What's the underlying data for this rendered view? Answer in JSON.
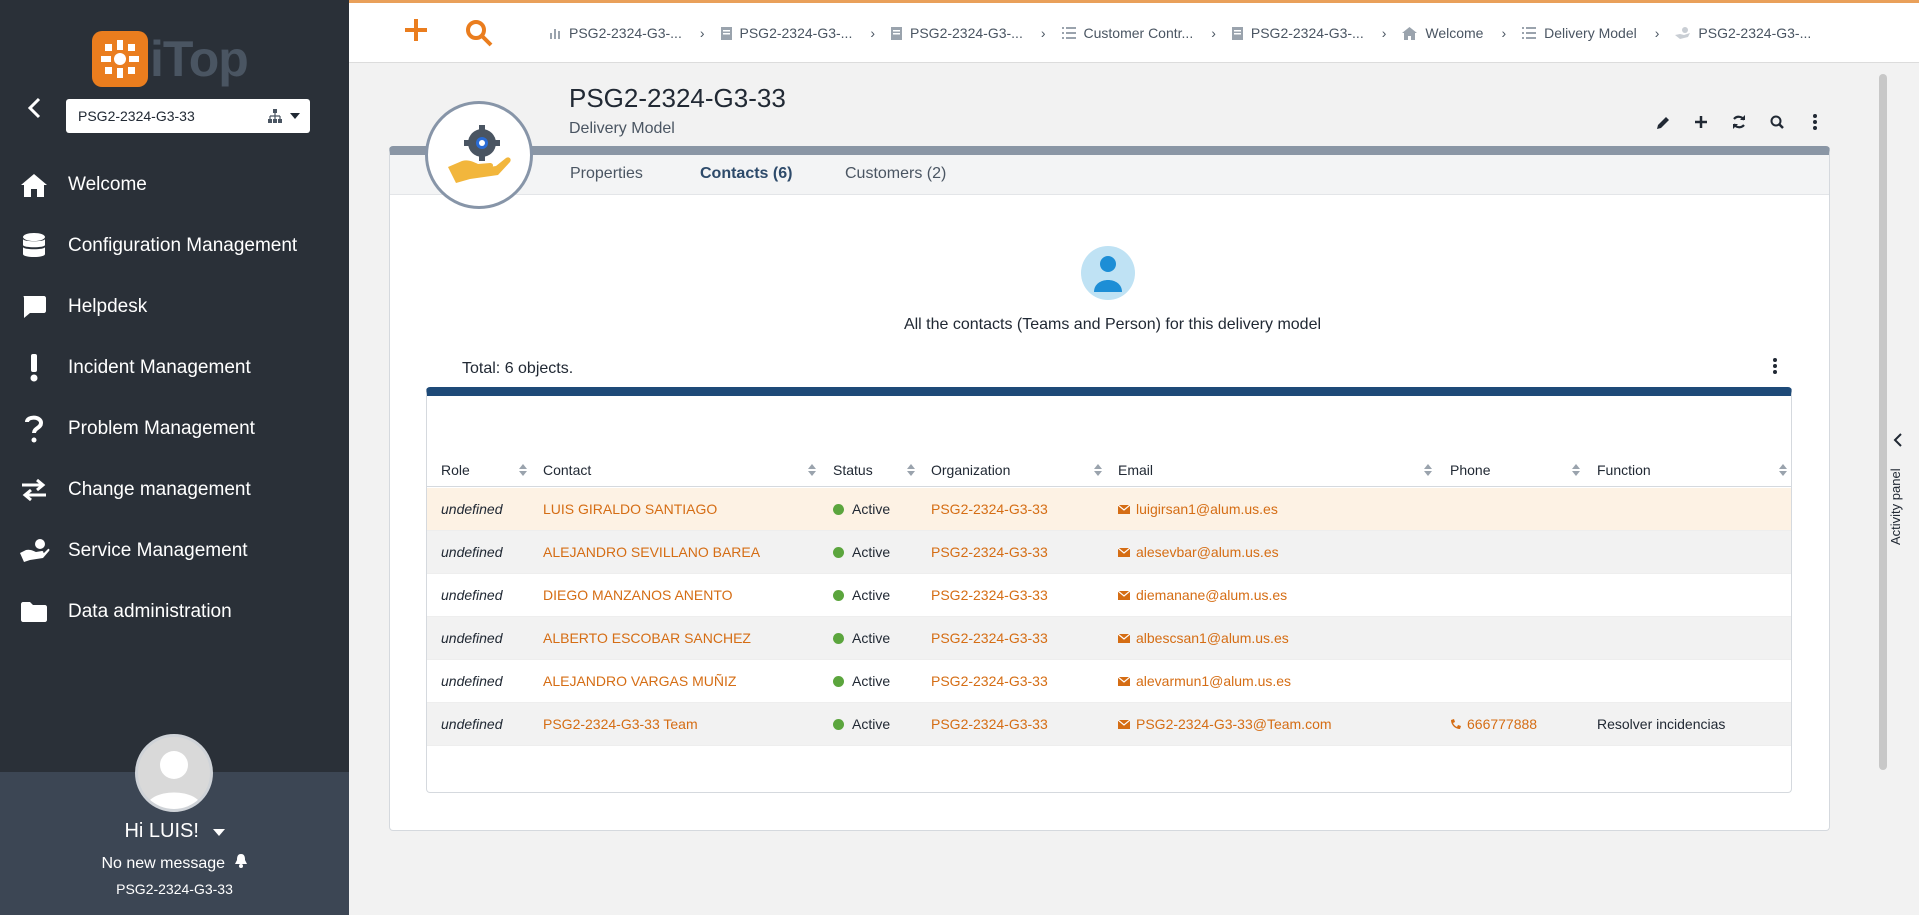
{
  "app": {
    "logo_text": "iTop"
  },
  "sidebar": {
    "org_select_value": "PSG2-2324-G3-33",
    "items": [
      {
        "label": "Welcome",
        "icon": "home-icon"
      },
      {
        "label": "Configuration Management",
        "icon": "database-icon"
      },
      {
        "label": "Helpdesk",
        "icon": "chat-icon"
      },
      {
        "label": "Incident Management",
        "icon": "exclamation-icon"
      },
      {
        "label": "Problem Management",
        "icon": "question-icon"
      },
      {
        "label": "Change management",
        "icon": "exchange-icon"
      },
      {
        "label": "Service Management",
        "icon": "hand-icon"
      },
      {
        "label": "Data administration",
        "icon": "folder-icon"
      }
    ],
    "user": {
      "greeting": "Hi LUIS!",
      "messages": "No new message",
      "organization": "PSG2-2324-G3-33"
    }
  },
  "breadcrumbs": [
    {
      "label": "PSG2-2324-G3-...",
      "icon": "chart-icon"
    },
    {
      "label": "PSG2-2324-G3-...",
      "icon": "document-icon"
    },
    {
      "label": "PSG2-2324-G3-...",
      "icon": "document-icon"
    },
    {
      "label": "Customer Contr...",
      "icon": "list-icon"
    },
    {
      "label": "PSG2-2324-G3-...",
      "icon": "document-icon"
    },
    {
      "label": "Welcome",
      "icon": "home-icon"
    },
    {
      "label": "Delivery Model",
      "icon": "list-icon"
    },
    {
      "label": "PSG2-2324-G3-...",
      "icon": "hand-icon"
    }
  ],
  "object": {
    "title": "PSG2-2324-G3-33",
    "subtitle": "Delivery Model"
  },
  "tabs": [
    {
      "label": "Properties",
      "active": false
    },
    {
      "label": "Contacts (6)",
      "active": true
    },
    {
      "label": "Customers (2)",
      "active": false
    }
  ],
  "contacts": {
    "description": "All the contacts (Teams and Person) for this delivery model",
    "total": "Total: 6 objects.",
    "columns": [
      "Role",
      "Contact",
      "Status",
      "Organization",
      "Email",
      "Phone",
      "Function"
    ],
    "rows": [
      {
        "role": "undefined",
        "contact": "LUIS GIRALDO SANTIAGO",
        "status": "Active",
        "organization": "PSG2-2324-G3-33",
        "email": "luigirsan1@alum.us.es",
        "phone": "",
        "function": ""
      },
      {
        "role": "undefined",
        "contact": "ALEJANDRO SEVILLANO BAREA",
        "status": "Active",
        "organization": "PSG2-2324-G3-33",
        "email": "alesevbar@alum.us.es",
        "phone": "",
        "function": ""
      },
      {
        "role": "undefined",
        "contact": "DIEGO MANZANOS ANENTO",
        "status": "Active",
        "organization": "PSG2-2324-G3-33",
        "email": "diemanane@alum.us.es",
        "phone": "",
        "function": ""
      },
      {
        "role": "undefined",
        "contact": "ALBERTO ESCOBAR SANCHEZ",
        "status": "Active",
        "organization": "PSG2-2324-G3-33",
        "email": "albescsan1@alum.us.es",
        "phone": "",
        "function": ""
      },
      {
        "role": "undefined",
        "contact": "ALEJANDRO VARGAS MUÑIZ",
        "status": "Active",
        "organization": "PSG2-2324-G3-33",
        "email": "alevarmun1@alum.us.es",
        "phone": "",
        "function": ""
      },
      {
        "role": "undefined",
        "contact": "PSG2-2324-G3-33 Team",
        "status": "Active",
        "organization": "PSG2-2324-G3-33",
        "email": "PSG2-2324-G3-33@Team.com",
        "phone": "666777888",
        "function": "Resolver incidencias"
      }
    ]
  },
  "activity_panel": {
    "label": "Activity panel"
  },
  "colors": {
    "accent": "#ea7d1e",
    "link": "#d56d14",
    "sidebar": "#2a3038",
    "status_active": "#5ba53d",
    "table_header_bar": "#1e4a78"
  }
}
